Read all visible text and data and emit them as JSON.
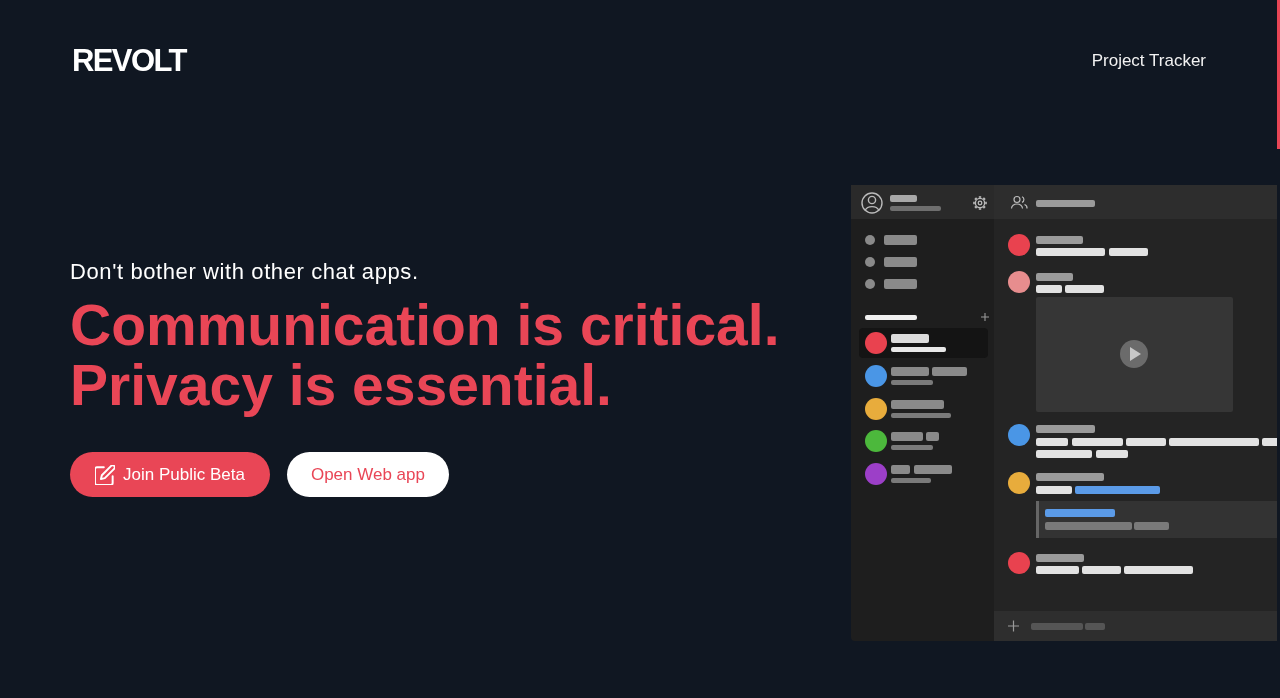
{
  "header": {
    "logo": "REVOLT",
    "nav_links": [
      "Project Tracker"
    ]
  },
  "hero": {
    "tagline": "Don't bother with other chat apps.",
    "headline": [
      "Communication is critical.",
      "Privacy is essential."
    ],
    "buttons": [
      {
        "label": "Join Public Beta",
        "kind": "primary"
      },
      {
        "label": "Open Web app",
        "kind": "secondary"
      }
    ]
  }
}
